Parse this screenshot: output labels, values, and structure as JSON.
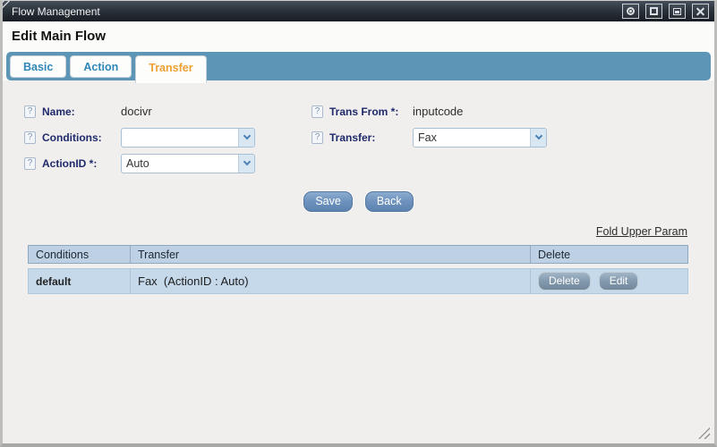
{
  "window": {
    "title": "Flow Management",
    "controls": [
      "collapse-icon",
      "maximize-icon",
      "minimize-icon",
      "close-icon"
    ]
  },
  "heading": "Edit Main Flow",
  "tabs": [
    {
      "label": "Basic",
      "active": false
    },
    {
      "label": "Action",
      "active": false
    },
    {
      "label": "Transfer",
      "active": true
    }
  ],
  "form": {
    "help_glyph": "?",
    "left": [
      {
        "label": "Name:",
        "type": "text",
        "value": "docivr"
      },
      {
        "label": "Conditions:",
        "type": "select",
        "value": ""
      },
      {
        "label": "ActionID *:",
        "type": "select",
        "value": "Auto"
      }
    ],
    "right": [
      {
        "label": "Trans From *:",
        "type": "text",
        "value": "inputcode"
      },
      {
        "label": "Transfer:",
        "type": "select",
        "value": "Fax"
      }
    ],
    "save_label": "Save",
    "back_label": "Back"
  },
  "fold_link": "Fold Upper Param",
  "table": {
    "columns": [
      "Conditions",
      "Transfer",
      "Delete"
    ],
    "rows": [
      {
        "conditions": "default",
        "transfer": "Fax  (ActionID : Auto)",
        "actions": [
          "Delete",
          "Edit"
        ]
      }
    ]
  },
  "colors": {
    "titlebar": "#2b333b",
    "tab_bar": "#5d95b6",
    "tab_text": "#2f87b8",
    "tab_active_text": "#eea133",
    "label": "#1f2a6b",
    "table_header_bg": "#bdd0e4",
    "table_row_bg": "#c6d9ea",
    "button_blue": "#6d92bd",
    "button_grey": "#8299ae"
  }
}
